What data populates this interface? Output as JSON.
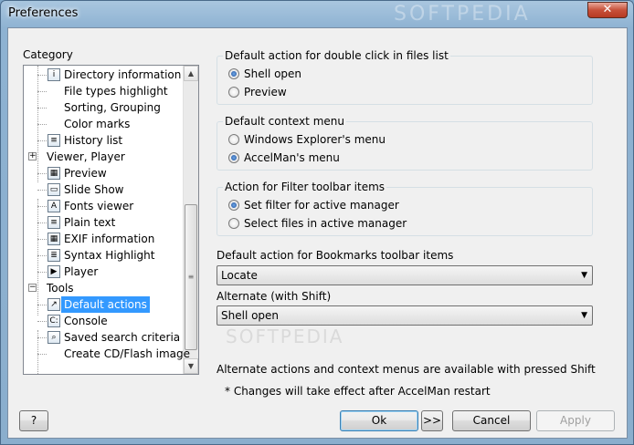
{
  "window": {
    "title": "Preferences",
    "close_glyph": "✕"
  },
  "sidebar": {
    "category_label": "Category",
    "items": [
      {
        "label": "Directory information",
        "icon": "info-icon",
        "level": 1
      },
      {
        "label": "File types highlight",
        "icon": "",
        "level": 1
      },
      {
        "label": "Sorting, Grouping",
        "icon": "",
        "level": 1
      },
      {
        "label": "Color marks",
        "icon": "",
        "level": 1
      },
      {
        "label": "History list",
        "icon": "history-icon",
        "level": 1
      },
      {
        "label": "Viewer, Player",
        "icon": "",
        "level": 0,
        "expander": "+"
      },
      {
        "label": "Preview",
        "icon": "preview-icon",
        "level": 1
      },
      {
        "label": "Slide Show",
        "icon": "slideshow-icon",
        "level": 1
      },
      {
        "label": "Fonts viewer",
        "icon": "font-icon",
        "level": 1
      },
      {
        "label": "Plain text",
        "icon": "text-icon",
        "level": 1
      },
      {
        "label": "EXIF information",
        "icon": "exif-icon",
        "level": 1
      },
      {
        "label": "Syntax Highlight",
        "icon": "syntax-icon",
        "level": 1
      },
      {
        "label": "Player",
        "icon": "player-icon",
        "level": 1
      },
      {
        "label": "Tools",
        "icon": "",
        "level": 0,
        "expander": "−"
      },
      {
        "label": "Default actions",
        "icon": "shortcut-icon",
        "level": 1,
        "selected": true
      },
      {
        "label": "Console",
        "icon": "console-icon",
        "level": 1
      },
      {
        "label": "Saved search criteria",
        "icon": "search-icon",
        "level": 1
      },
      {
        "label": "Create CD/Flash image",
        "icon": "",
        "level": 1
      }
    ]
  },
  "main": {
    "double_click_group": {
      "label": "Default action for double click in files list",
      "options": [
        "Shell open",
        "Preview"
      ],
      "selected": 0
    },
    "context_menu_group": {
      "label": "Default context menu",
      "options": [
        "Windows Explorer's menu",
        "AccelMan's menu"
      ],
      "selected": 1
    },
    "filter_group": {
      "label": "Action for Filter toolbar items",
      "options": [
        "Set filter for active manager",
        "Select files in active manager"
      ],
      "selected": 0
    },
    "bookmarks": {
      "label": "Default action for Bookmarks toolbar items",
      "value": "Locate"
    },
    "alternate": {
      "label": "Alternate (with Shift)",
      "value": "Shell open"
    },
    "note1": "Alternate actions and context menus are available with pressed Shift",
    "note2": "* Changes will take effect after AccelMan restart"
  },
  "footer": {
    "help_label": "?",
    "ok_label": "Ok",
    "more_label": ">>",
    "cancel_label": "Cancel",
    "apply_label": "Apply"
  },
  "watermark": {
    "top": "SOFTPEDIA",
    "mid": "SOFTPEDIA"
  }
}
